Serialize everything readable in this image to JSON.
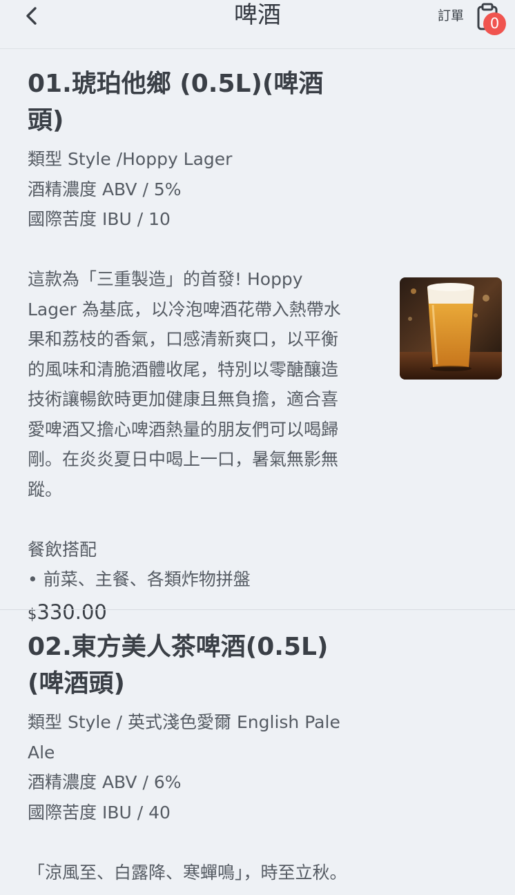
{
  "header": {
    "title": "啤酒",
    "order_label": "訂單",
    "cart_count": "0",
    "badge_color": "#f0544f"
  },
  "items": [
    {
      "title": "01.琥珀他鄉 (0.5L)(啤酒頭)",
      "style": "類型 Style /Hoppy Lager",
      "abv": "酒精濃度 ABV / 5%",
      "ibu": "國際苦度 IBU / 10",
      "description": "這款為「三重製造」的首發! Hoppy Lager 為基底，以冷泡啤酒花帶入熱帶水果和荔枝的香氣，口感清新爽口，以平衡的風味和清脆酒體收尾，特別以零醣釀造技術讓暢飲時更加健康且無負擔，適合喜愛啤酒又擔心啤酒熱量的朋友們可以喝歸剛。在炎炎夏日中喝上一口，暑氣無影無蹤。",
      "pairing_title": "餐飲搭配",
      "pairing": "• 前菜、主餐、各類炸物拼盤",
      "currency": "$",
      "price": "330.00",
      "image": "beer-glass-photo"
    },
    {
      "title": "02.東方美人茶啤酒(0.5L)(啤酒頭)",
      "style": "類型 Style / 英式淺色愛爾 English Pale Ale",
      "abv": "酒精濃度 ABV / 6%",
      "ibu": "國際苦度 IBU / 40",
      "description": "「涼風至、白露降、寒蟬鳴」，時至立秋。"
    }
  ]
}
